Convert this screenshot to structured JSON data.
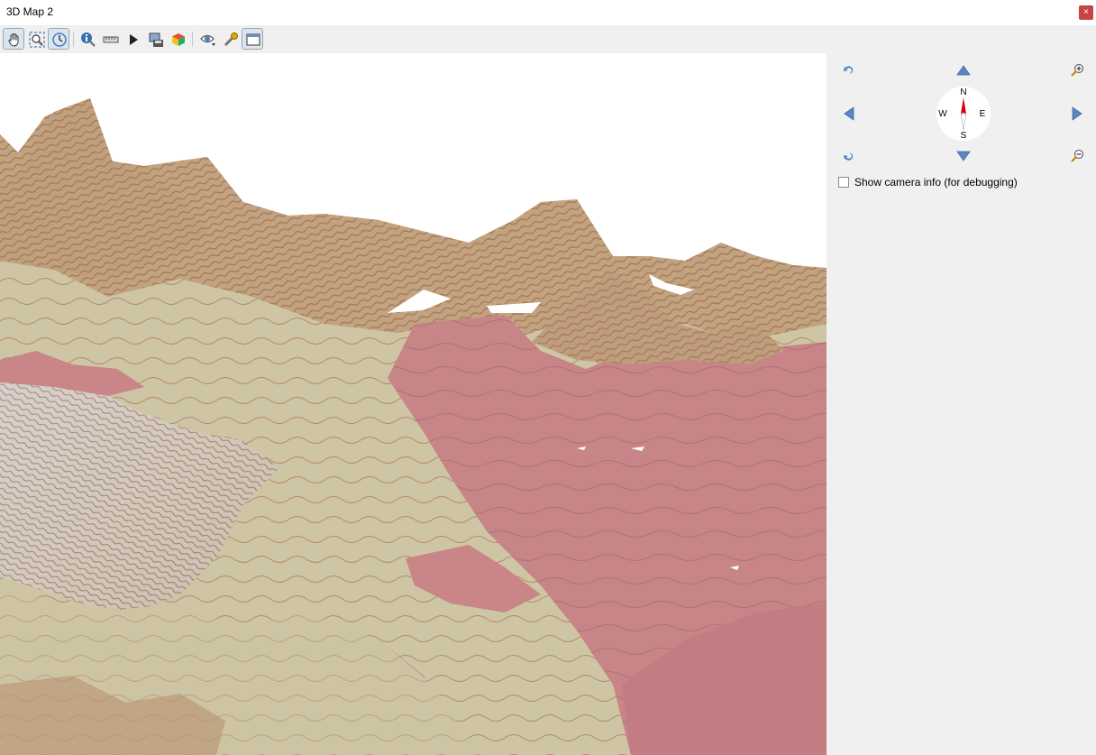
{
  "window": {
    "title": "3D Map 2",
    "close_glyph": "×"
  },
  "toolbar": {
    "items": [
      {
        "icon": "pan-hand-icon",
        "checked": true
      },
      {
        "icon": "zoom-full-icon",
        "checked": false
      },
      {
        "icon": "camera-control-icon",
        "checked": true
      },
      {
        "icon": "identify-icon",
        "checked": false
      },
      {
        "icon": "measure-line-icon",
        "checked": false
      },
      {
        "icon": "animation-play-icon",
        "checked": false
      },
      {
        "icon": "save-image-icon",
        "checked": false
      },
      {
        "icon": "export-scene-icon",
        "checked": false
      },
      {
        "icon": "camera-view-icon",
        "checked": false
      },
      {
        "icon": "configure-icon",
        "checked": false
      },
      {
        "icon": "dock-window-icon",
        "checked": true
      }
    ]
  },
  "navigation": {
    "compass": {
      "north": "N",
      "south": "S",
      "east": "E",
      "west": "W"
    },
    "camera_info_label": "Show camera info (for debugging)",
    "camera_info_checked": false
  },
  "colors": {
    "accent_blue": "#4a7fc1",
    "close_red": "#c84545",
    "terrain_pink": "#c9858a",
    "terrain_tan": "#cfc7a6",
    "terrain_brown": "#b98a68"
  }
}
